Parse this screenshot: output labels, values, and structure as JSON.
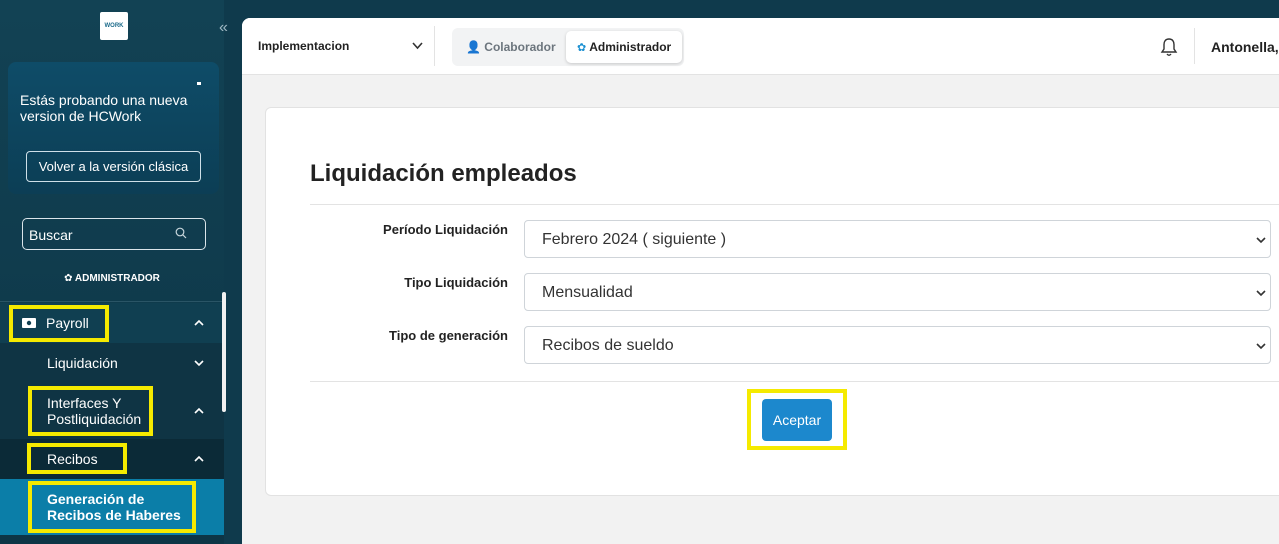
{
  "sidebar": {
    "logo_text": "WORK",
    "promo": {
      "text": "Estás probando una nueva version de HCWork",
      "button": "Volver a la versión clásica"
    },
    "search_placeholder": "Buscar",
    "role_label": "ADMINISTRADOR",
    "menu": {
      "payroll": "Payroll",
      "liquidacion": "Liquidación",
      "interfaces": "Interfaces Y Postliquidación",
      "recibos": "Recibos",
      "generacion": "Generación de Recibos de Haberes"
    }
  },
  "header": {
    "company": "Implementacion",
    "toggle": {
      "colaborador": "Colaborador",
      "administrador": "Administrador"
    },
    "user": "Antonella,"
  },
  "main": {
    "title": "Liquidación empleados",
    "fields": [
      {
        "label": "Período Liquidación",
        "value": "Febrero 2024 ( siguiente )"
      },
      {
        "label": "Tipo Liquidación",
        "value": "Mensualidad"
      },
      {
        "label": "Tipo de generación",
        "value": "Recibos de sueldo"
      }
    ],
    "accept_label": "Aceptar"
  },
  "colors": {
    "sidebar": "#0f3a4c",
    "active_item": "#0b7ea8",
    "highlight": "#f5ea00",
    "primary_button": "#1c88cd"
  }
}
